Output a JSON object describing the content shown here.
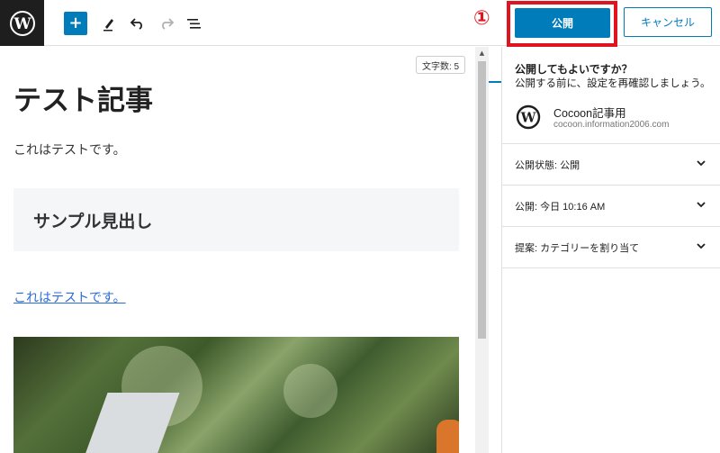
{
  "toolbar": {
    "logo_icon": "wordpress-icon",
    "add_icon": "plus-icon",
    "add_label": "+",
    "tools_icon": "pencil-icon",
    "undo_icon": "undo-icon",
    "redo_icon": "redo-icon",
    "outline_icon": "list-view-icon",
    "step_marker": "①",
    "publish_label": "公開",
    "cancel_label": "キャンセル"
  },
  "editor": {
    "word_count": "文字数: 5",
    "title": "テスト記事",
    "paragraph": "これはテストです。",
    "heading": "サンプル見出し",
    "link_paragraph": "これはテストです。",
    "image_alt": "laptop-photo"
  },
  "prepublish": {
    "title": "公開してもよいですか？",
    "subtitle": "公開する前に、設定を再確認しましょう。",
    "site_name": "Cocoon記事用",
    "site_url": "cocoon.information2006.com",
    "panels": [
      {
        "label": "公開状態: 公開"
      },
      {
        "label": "公開: 今日 10:16 AM"
      },
      {
        "label": "提案: カテゴリーを割り当て"
      }
    ]
  },
  "colors": {
    "accent": "#007cba",
    "highlight": "#e0141e",
    "header_dark": "#1e1e1e"
  }
}
